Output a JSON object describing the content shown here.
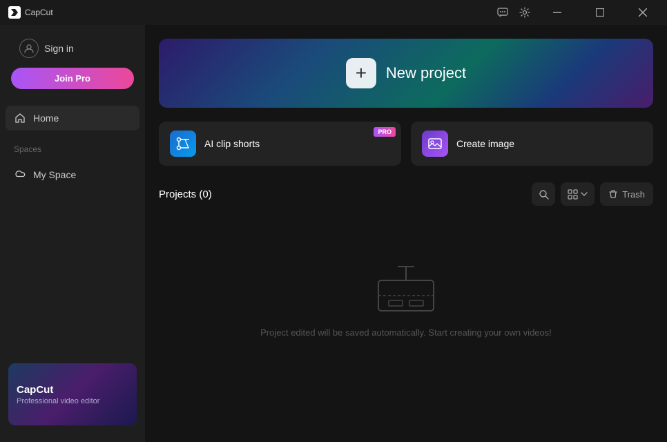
{
  "app": {
    "name": "CapCut",
    "subtitle": "CapCut"
  },
  "titlebar": {
    "title": "CapCut",
    "controls": {
      "feedback": "feedback-icon",
      "settings": "settings-icon",
      "minimize": "minimize-icon",
      "maximize": "maximize-icon",
      "close": "close-icon"
    }
  },
  "sidebar": {
    "sign_in": "Sign in",
    "join_pro": "Join Pro",
    "nav": [
      {
        "id": "home",
        "label": "Home",
        "icon": "home"
      }
    ],
    "spaces_label": "Spaces",
    "spaces": [
      {
        "id": "my-space",
        "label": "My Space",
        "icon": "cloud"
      }
    ],
    "promo": {
      "title": "CapCut",
      "subtitle": "Professional video editor"
    }
  },
  "main": {
    "new_project": {
      "label": "New project",
      "plus": "+"
    },
    "feature_cards": [
      {
        "id": "ai-clip-shorts",
        "label": "AI clip shorts",
        "icon": "✂",
        "color": "blue",
        "pro": true,
        "pro_label": "PRO"
      },
      {
        "id": "create-image",
        "label": "Create image",
        "icon": "🖼",
        "color": "purple",
        "pro": false
      }
    ],
    "projects": {
      "title": "Projects (0)",
      "count": 0,
      "empty_text": "Project edited will be saved automatically. Start creating your own videos!"
    },
    "toolbar": {
      "search_label": "search",
      "view_label": "view-toggle",
      "trash_label": "Trash"
    }
  }
}
